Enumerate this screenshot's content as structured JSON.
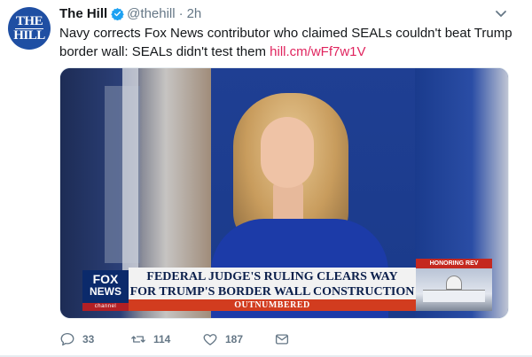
{
  "tweet": {
    "author": {
      "avatar_text_top": "THE",
      "avatar_text_bottom": "HILL",
      "display_name": "The Hill",
      "handle": "@thehill",
      "separator": "·",
      "time": "2h"
    },
    "text": "Navy corrects Fox News contributor who claimed SEALs couldn't beat Trump border wall: SEALs didn't test them",
    "link": "hill.cm/wFf7w1V",
    "media": {
      "network_logo_top": "FOX",
      "network_logo_mid": "NEWS",
      "network_logo_bottom": "channel",
      "headline_line1": "FEDERAL JUDGE'S RULING CLEARS WAY",
      "headline_line2": "FOR TRUMP'S BORDER WALL CONSTRUCTION",
      "show_name": "OUTNUMBERED",
      "side_banner": "HONORING REV GRAHAM"
    },
    "actions": {
      "reply_count": "33",
      "retweet_count": "114",
      "like_count": "187"
    }
  },
  "colors": {
    "link": "#e0245e",
    "verified": "#1da1f2",
    "muted": "#657786",
    "avatar": "#1f4fa3"
  },
  "icons": [
    "verified-badge-icon",
    "chevron-down-icon",
    "reply-icon",
    "retweet-icon",
    "like-icon",
    "direct-message-icon"
  ]
}
